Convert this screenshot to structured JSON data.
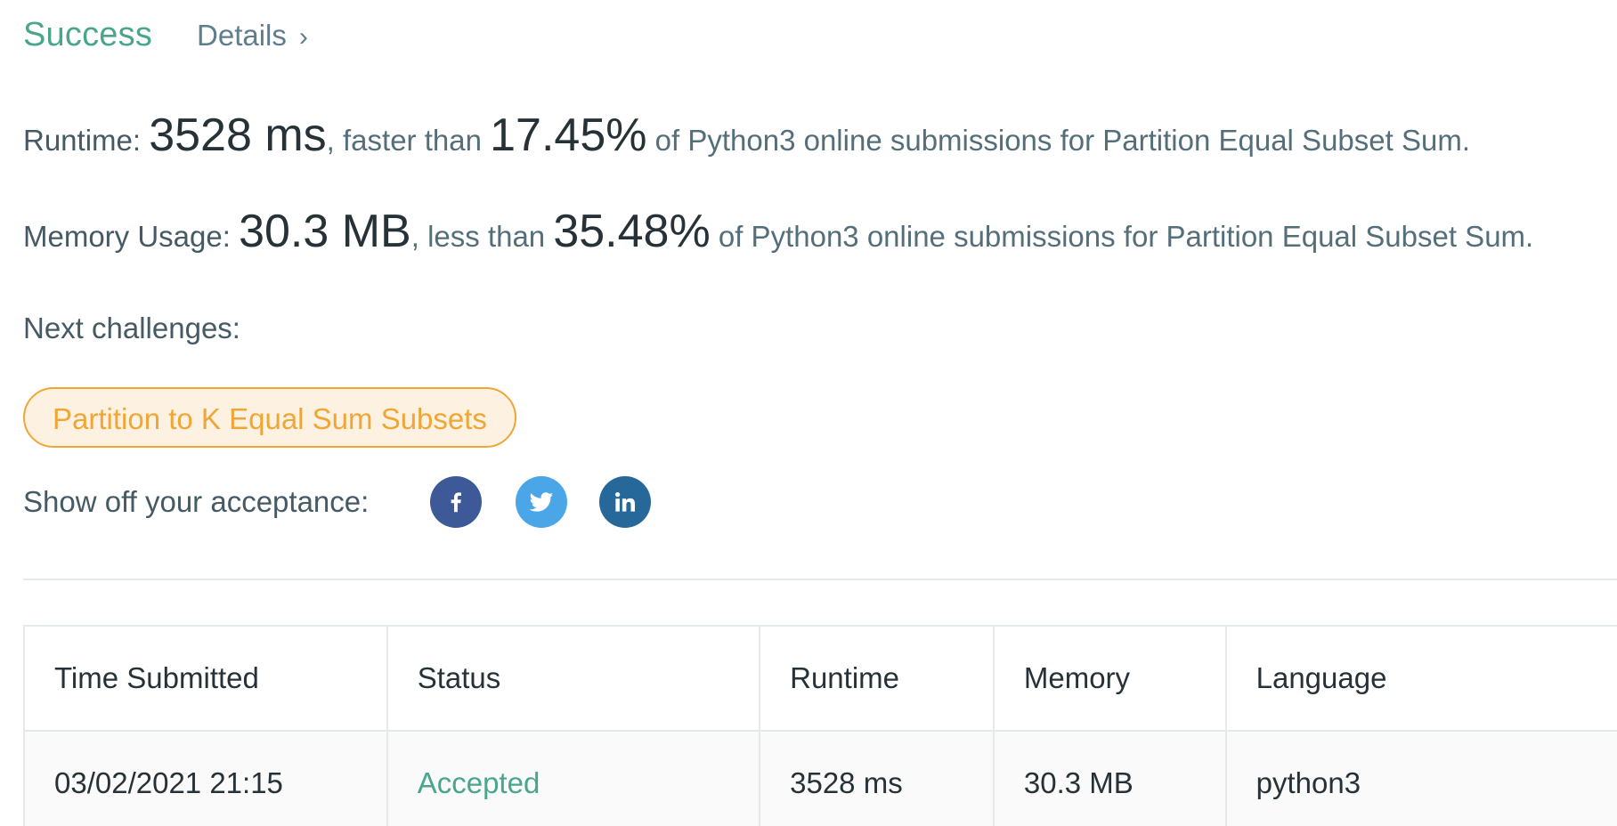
{
  "header": {
    "status": "Success",
    "details_label": "Details",
    "details_chevron": "›"
  },
  "runtime": {
    "label": "Runtime: ",
    "value": "3528 ms",
    "comparison": ", faster than ",
    "percent": "17.45%",
    "suffix": " of Python3 online submissions for Partition Equal Subset Sum."
  },
  "memory": {
    "label": "Memory Usage: ",
    "value": "30.3 MB",
    "comparison": ", less than ",
    "percent": "35.48%",
    "suffix": " of Python3 online submissions for Partition Equal Subset Sum."
  },
  "next": {
    "label": "Next challenges:",
    "challenges": [
      "Partition to K Equal Sum Subsets"
    ]
  },
  "share": {
    "label": "Show off your acceptance:",
    "icons": [
      "facebook-icon",
      "twitter-icon",
      "linkedin-icon"
    ],
    "colors": {
      "facebook": "#3d5998",
      "twitter": "#4ba6e8",
      "linkedin": "#27689a"
    }
  },
  "table": {
    "headers": [
      "Time Submitted",
      "Status",
      "Runtime",
      "Memory",
      "Language"
    ],
    "rows": [
      [
        "03/02/2021 21:15",
        "Accepted",
        "3528 ms",
        "30.3 MB",
        "python3"
      ]
    ]
  },
  "colors": {
    "success": "#4aa58d",
    "challenge_accent": "#f0a637",
    "challenge_bg": "#fdf2e1"
  }
}
